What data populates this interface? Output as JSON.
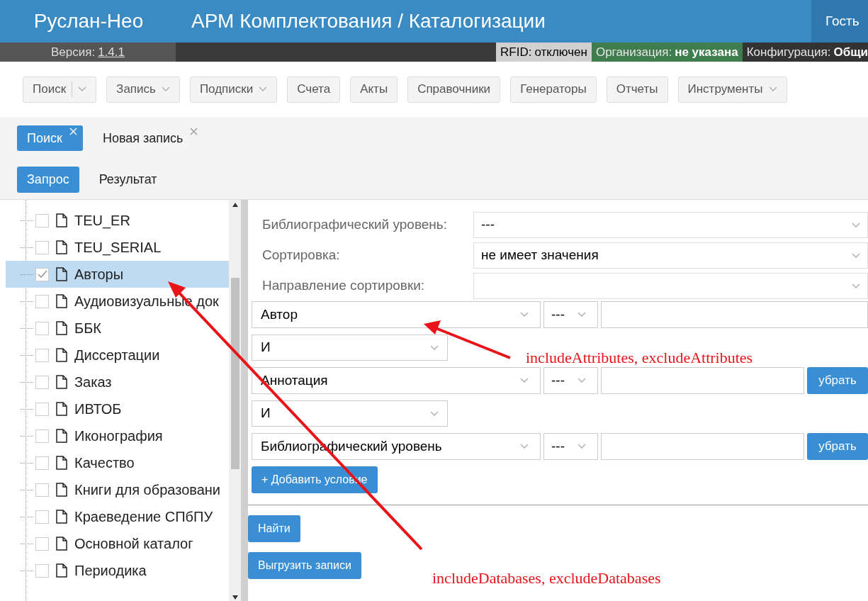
{
  "header": {
    "brand": "Руслан-Нео",
    "title": "АРМ Комплектования / Каталогизации",
    "user": "Гость"
  },
  "status_bar": {
    "version_label": "Версия:",
    "version": "1.4.1",
    "rfid_label": "RFID:",
    "rfid": "отключен",
    "org_label": "Организация:",
    "org": "не указана",
    "config_label": "Конфигурация:",
    "config": "Общи"
  },
  "toolbar": [
    {
      "label": "Поиск",
      "kind": "split"
    },
    {
      "label": "Запись",
      "kind": "dropdown"
    },
    {
      "label": "Подписки",
      "kind": "dropdown"
    },
    {
      "label": "Счета",
      "kind": "plain"
    },
    {
      "label": "Акты",
      "kind": "plain"
    },
    {
      "label": "Справочники",
      "kind": "plain"
    },
    {
      "label": "Генераторы",
      "kind": "plain"
    },
    {
      "label": "Отчеты",
      "kind": "plain"
    },
    {
      "label": "Инструменты",
      "kind": "dropdown"
    }
  ],
  "tabs": [
    {
      "label": "Поиск",
      "selected": true
    },
    {
      "label": "Новая запись",
      "selected": false
    }
  ],
  "subtabs": [
    {
      "label": "Запрос",
      "selected": true
    },
    {
      "label": "Результат",
      "selected": false
    }
  ],
  "databases": [
    {
      "label": "TEU_ER",
      "checked": false,
      "selected": false
    },
    {
      "label": "TEU_SERIAL",
      "checked": false,
      "selected": false
    },
    {
      "label": "Авторы",
      "checked": true,
      "selected": true
    },
    {
      "label": "Аудиовизуальные док",
      "checked": false,
      "selected": false
    },
    {
      "label": "ББК",
      "checked": false,
      "selected": false
    },
    {
      "label": "Диссертации",
      "checked": false,
      "selected": false
    },
    {
      "label": "Заказ",
      "checked": false,
      "selected": false
    },
    {
      "label": "ИВТОБ",
      "checked": false,
      "selected": false
    },
    {
      "label": "Иконография",
      "checked": false,
      "selected": false
    },
    {
      "label": "Качество",
      "checked": false,
      "selected": false
    },
    {
      "label": "Книги для образовани",
      "checked": false,
      "selected": false
    },
    {
      "label": "Краеведение СПбПУ",
      "checked": false,
      "selected": false
    },
    {
      "label": "Основной каталог",
      "checked": false,
      "selected": false
    },
    {
      "label": "Периодика",
      "checked": false,
      "selected": false
    }
  ],
  "form": {
    "fields": [
      {
        "label": "Библиографический уровень:",
        "value": "---"
      },
      {
        "label": "Сортировка:",
        "value": "не имеет значения"
      },
      {
        "label": "Направление сортировки:"
      }
    ],
    "conditions": [
      {
        "kind": "condition",
        "attribute": "Автор",
        "operator": "---",
        "removable": false
      },
      {
        "kind": "logic",
        "value": "И"
      },
      {
        "kind": "condition",
        "attribute": "Аннотация",
        "operator": "---",
        "removable": true,
        "remove_label": "убрать"
      },
      {
        "kind": "logic",
        "value": "И"
      },
      {
        "kind": "condition",
        "attribute": "Библиографический уровень",
        "operator": "---",
        "removable": true,
        "remove_label": "убрать"
      }
    ],
    "add_button": "+ Добавить условие",
    "find_button": "Найти",
    "export_button": "Выгрузить записи"
  },
  "annotations": [
    "includeAttributes, excludeAttributes",
    "includeDatabases, excludeDatabases"
  ]
}
